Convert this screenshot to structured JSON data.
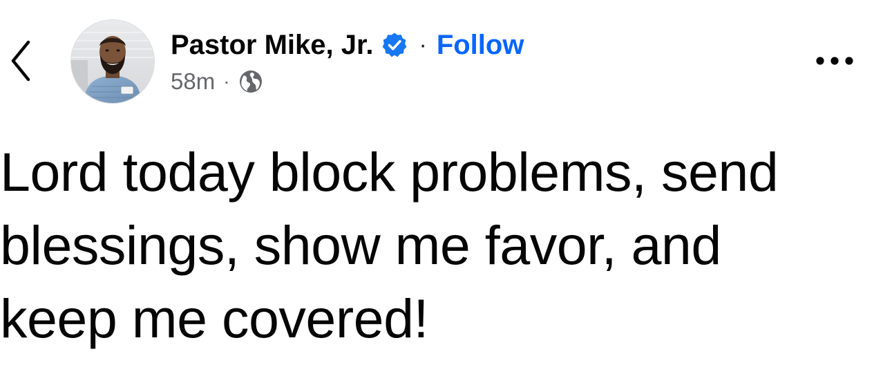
{
  "post": {
    "author": {
      "name": "Pastor Mike, Jr.",
      "verified": true,
      "follow_label": "Follow",
      "separator": "·"
    },
    "meta": {
      "timestamp": "58m",
      "separator": "·",
      "audience_icon": "globe-icon"
    },
    "text": "Lord today block problems, send\nblessings, show me favor, and\nkeep me covered!"
  },
  "icons": {
    "back": "chevron-left-icon",
    "verified": "verified-badge-icon",
    "more": "more-horizontal-icon"
  },
  "colors": {
    "link_blue": "#0866ff",
    "verified_blue": "#1877f2",
    "text_primary": "#050505",
    "text_secondary": "#65676b"
  }
}
